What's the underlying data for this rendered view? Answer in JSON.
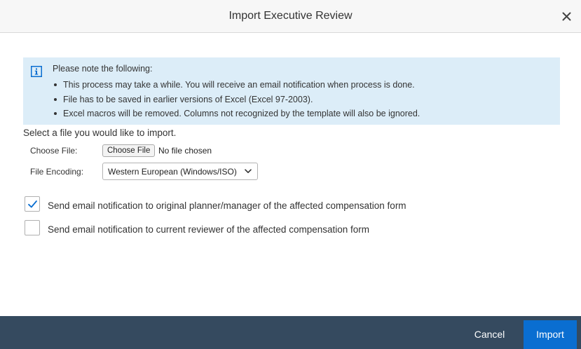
{
  "dialog": {
    "title": "Import Executive Review"
  },
  "info": {
    "heading": "Please note the following:",
    "items": [
      "This process may take a while. You will receive an email notification when process is done.",
      "File has to be saved in earlier versions of Excel (Excel 97-2003).",
      "Excel macros will be removed. Columns not recognized by the template will also be ignored."
    ]
  },
  "form": {
    "prompt": "Select a file you would like to import.",
    "choose_file_label": "Choose File:",
    "choose_file_button": "Choose File",
    "no_file_text": "No file chosen",
    "encoding_label": "File Encoding:",
    "encoding_value": "Western European (Windows/ISO)"
  },
  "notifications": [
    {
      "label": "Send email notification to original planner/manager of the affected compensation form",
      "checked": true
    },
    {
      "label": "Send email notification to current reviewer of the affected compensation form",
      "checked": false
    }
  ],
  "footer": {
    "cancel_label": "Cancel",
    "import_label": "Import"
  },
  "icons": {
    "close": "close-icon",
    "info": "info-icon",
    "check": "checkmark-icon",
    "dropdown": "chevron-down-icon"
  },
  "colors": {
    "info_bg": "#dcedf8",
    "accent": "#0a6ed1",
    "footer_bg": "#354a5f"
  }
}
